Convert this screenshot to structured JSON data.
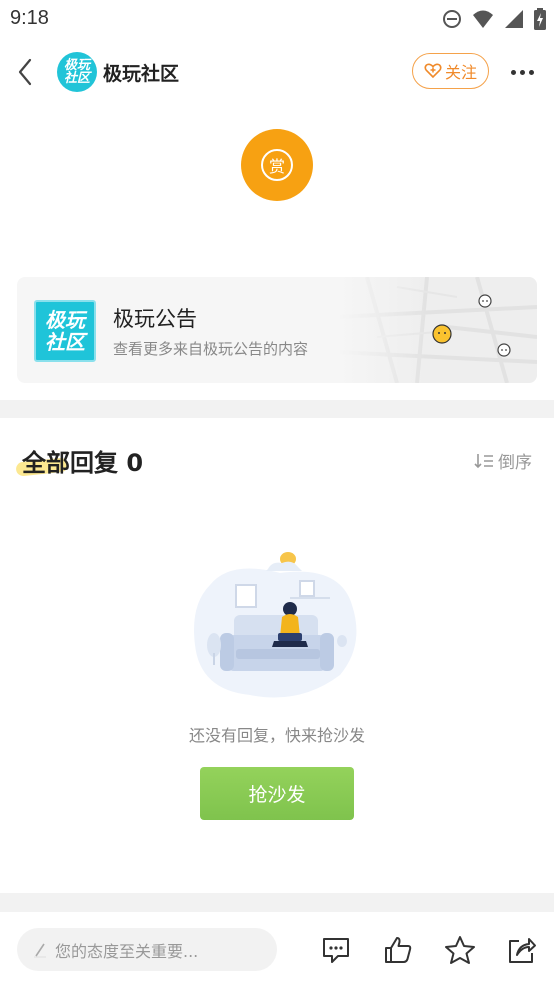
{
  "status_bar": {
    "time": "9:18"
  },
  "header": {
    "logo_text_line1": "极玩",
    "logo_text_line2": "社区",
    "title": "极玩社区",
    "follow_label": "关注"
  },
  "reward": {
    "label": "赏"
  },
  "community_card": {
    "logo_line1": "极玩",
    "logo_line2": "社区",
    "title": "极玩公告",
    "subtitle": "查看更多来自极玩公告的内容"
  },
  "replies": {
    "title": "全部回复 0",
    "sort_label": "倒序",
    "empty_text": "还没有回复，快来抢沙发",
    "sofa_button_label": "抢沙发"
  },
  "bottom_bar": {
    "input_placeholder": "您的态度至关重要..."
  },
  "colors": {
    "accent_orange": "#f7a112",
    "follow_orange": "#f08a2a",
    "brand_cyan": "#1fc4d9",
    "button_green": "#8ccc56"
  },
  "icons": [
    "back-icon",
    "heart-plus-icon",
    "more-icon",
    "reward-icon",
    "sort-icon",
    "pencil-icon",
    "comment-icon",
    "like-icon",
    "star-icon",
    "share-icon",
    "dnd-icon",
    "wifi-icon",
    "signal-icon",
    "battery-icon"
  ]
}
